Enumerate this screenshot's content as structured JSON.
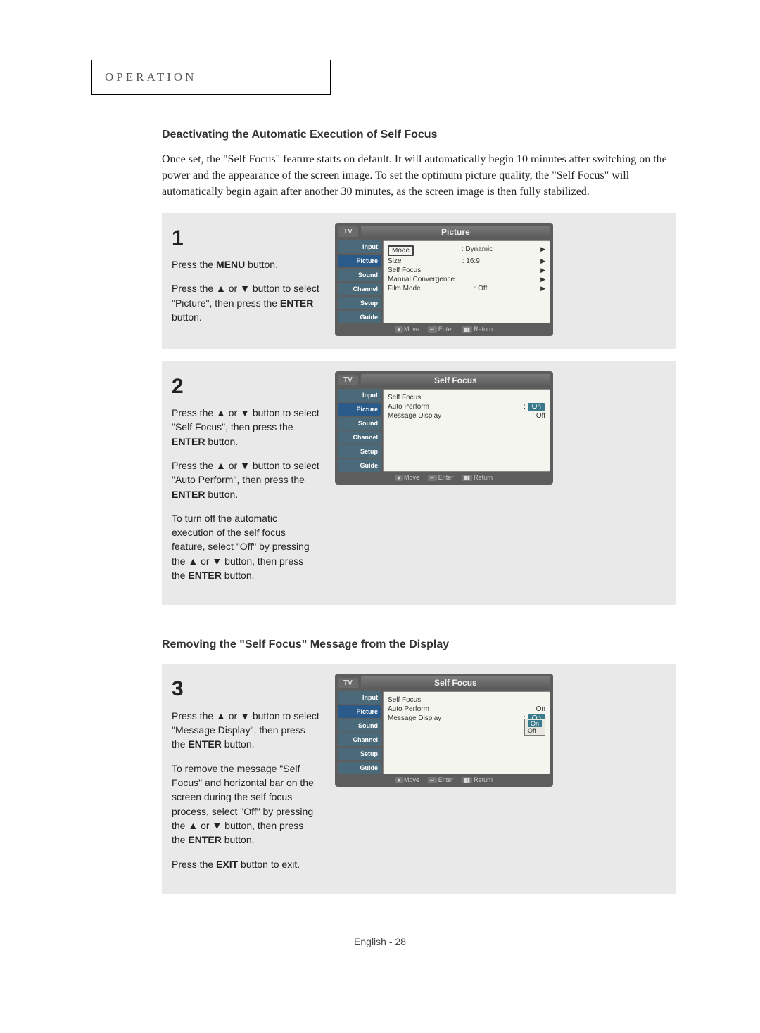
{
  "header": {
    "label": "OPERATION"
  },
  "section1": {
    "title": "Deactivating the Automatic Execution of Self Focus",
    "intro": "Once set, the \"Self Focus\" feature starts on default. It will automatically begin 10 minutes after switching on the power and the appearance of the screen image. To set the optimum picture quality, the \"Self Focus\" will automatically begin again after another 30 minutes, as the screen image is then fully stabilized."
  },
  "steps": {
    "step1": {
      "num": "1",
      "p1a": "Press the ",
      "p1b": "MENU",
      "p1c": " button.",
      "p2a": "Press the ▲ or ▼ button to select \"Picture\", then press the ",
      "p2b": "ENTER",
      "p2c": " button.",
      "shot": {
        "tv": "TV",
        "title": "Picture",
        "side": [
          "Input",
          "Picture",
          "Sound",
          "Channel",
          "Setup",
          "Guide"
        ],
        "rows": [
          {
            "l": "Mode",
            "r": ": Dynamic",
            "boxed": true,
            "arrow": true
          },
          {
            "l": "Size",
            "r": ": 16:9",
            "arrow": true
          },
          {
            "l": "Self Focus",
            "r": "",
            "arrow": true
          },
          {
            "l": "Manual Convergence",
            "r": "",
            "arrow": true
          },
          {
            "l": "Film Mode",
            "r": ": Off",
            "arrow": true
          }
        ],
        "footer": {
          "move": "Move",
          "enter": "Enter",
          "ret": "Return"
        }
      }
    },
    "step2": {
      "num": "2",
      "p1a": "Press the ▲ or ▼ button to select \"Self Focus\", then press the ",
      "p1b": "ENTER",
      "p1c": " button.",
      "p2a": "Press the ▲ or ▼ button to select \"Auto Perform\", then press the ",
      "p2b": "ENTER",
      "p2c": " button.",
      "p3a": "To turn off the automatic execution of the self focus feature, select \"Off\" by pressing the ▲ or ▼ button, then press the ",
      "p3b": "ENTER",
      "p3c": " button.",
      "shot": {
        "tv": "TV",
        "title": "Self Focus",
        "side": [
          "Input",
          "Picture",
          "Sound",
          "Channel",
          "Setup",
          "Guide"
        ],
        "rows": [
          {
            "l": "Self Focus",
            "r": ""
          },
          {
            "l": "Auto Perform",
            "r": ":",
            "hl": "On"
          },
          {
            "l": "Message Display",
            "r": ":  Off"
          }
        ],
        "footer": {
          "move": "Move",
          "enter": "Enter",
          "ret": "Return"
        }
      }
    }
  },
  "section2": {
    "title": "Removing the \"Self Focus\" Message from the Display"
  },
  "step3": {
    "num": "3",
    "p1a": "Press the ▲ or ▼ button to select \"Message Display\", then press the ",
    "p1b": "ENTER",
    "p1c": " button.",
    "p2": "To remove the message \"Self Focus\" and horizontal bar on the screen during the self focus process, select \"Off\" by pressing the ▲ or ▼ button, then press the ",
    "p2b": "ENTER",
    "p2c": " button.",
    "p3a": "Press the ",
    "p3b": "EXIT",
    "p3c": " button to exit.",
    "shot": {
      "tv": "TV",
      "title": "Self Focus",
      "side": [
        "Input",
        "Picture",
        "Sound",
        "Channel",
        "Setup",
        "Guide"
      ],
      "rows": [
        {
          "l": "Self Focus",
          "r": ""
        },
        {
          "l": "Auto Perform",
          "r": ":  On"
        },
        {
          "l": "Message Display",
          "r": ":",
          "hl": "On"
        }
      ],
      "dropdown": [
        "On",
        "Off"
      ],
      "footer": {
        "move": "Move",
        "enter": "Enter",
        "ret": "Return"
      }
    }
  },
  "footer": {
    "text": "English - 28"
  }
}
